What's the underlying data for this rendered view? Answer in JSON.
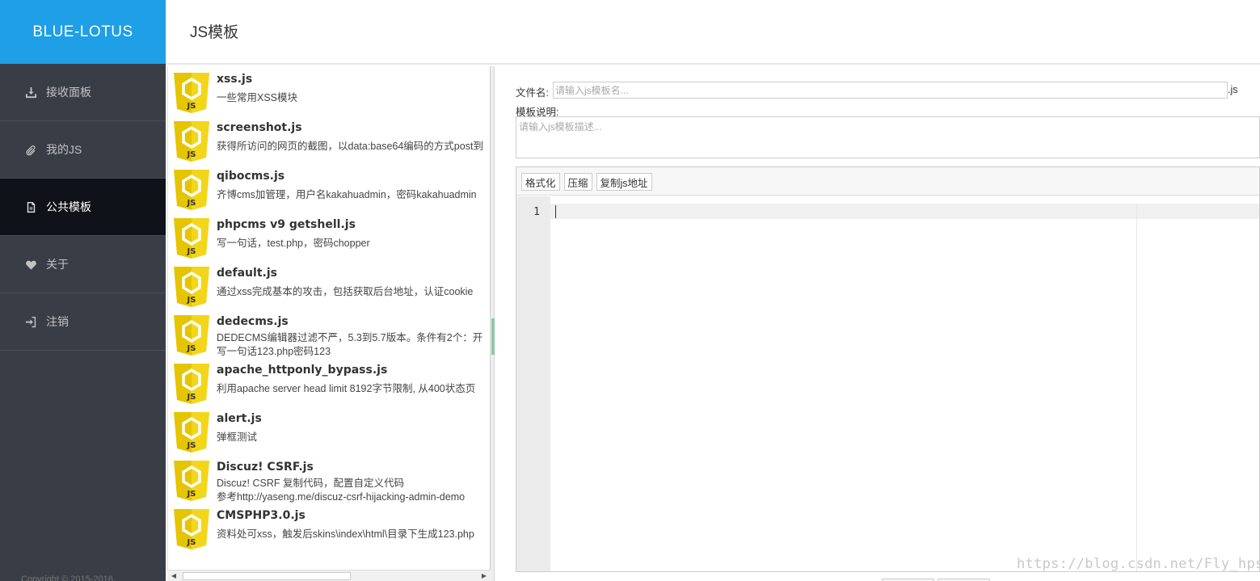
{
  "brand": "BLUE-LOTUS",
  "header": {
    "title": "JS模板"
  },
  "sidebar": {
    "items": [
      {
        "label": "接收面板",
        "icon": "download-icon",
        "active": false
      },
      {
        "label": "我的JS",
        "icon": "paperclip-icon",
        "active": false
      },
      {
        "label": "公共模板",
        "icon": "document-icon",
        "active": true
      },
      {
        "label": "关于",
        "icon": "heart-icon",
        "active": false
      },
      {
        "label": "注销",
        "icon": "logout-icon",
        "active": false
      }
    ],
    "copyright": "Copyright © 2015-2016"
  },
  "templates": [
    {
      "name": "xss.js",
      "desc": [
        "一些常用XSS模块"
      ]
    },
    {
      "name": "screenshot.js",
      "desc": [
        "获得所访问的网页的截图，以data:base64编码的方式post到"
      ]
    },
    {
      "name": "qibocms.js",
      "desc": [
        "齐博cms加管理，用户名kakahuadmin，密码kakahuadmin"
      ]
    },
    {
      "name": "phpcms v9 getshell.js",
      "desc": [
        "写一句话，test.php，密码chopper"
      ]
    },
    {
      "name": "default.js",
      "desc": [
        "通过xss完成基本的攻击，包括获取后台地址，认证cookie"
      ]
    },
    {
      "name": "dedecms.js",
      "desc": [
        "DEDECMS编辑器过滤不严，5.3到5.7版本。条件有2个：开",
        "写一句话123.php密码123"
      ]
    },
    {
      "name": "apache_httponly_bypass.js",
      "desc": [
        "利用apache server head limit 8192字节限制, 从400状态页"
      ]
    },
    {
      "name": "alert.js",
      "desc": [
        "弹框测试"
      ]
    },
    {
      "name": "Discuz!  CSRF.js",
      "desc": [
        "Discuz!  CSRF  复制代码，配置自定义代码",
        "参考http://yaseng.me/discuz-csrf-hijacking-admin-demo"
      ]
    },
    {
      "name": "CMSPHP3.0.js",
      "desc": [
        "资料处可xss，触发后skins\\index\\html\\目录下生成123.php"
      ]
    }
  ],
  "logo_text": "JS",
  "form": {
    "filename_label": "文件名:",
    "filename_placeholder": "请输入js模板名...",
    "filename_suffix": ".js",
    "desc_label": "模板说明:",
    "desc_placeholder": "请输入js模板描述..."
  },
  "editor": {
    "toolbar": {
      "format": "格式化",
      "compress": "压缩",
      "copy_url": "复制js地址"
    },
    "line_number": "1"
  },
  "watermark": "https://blog.csdn.net/Fly_hps",
  "colors": {
    "brand": "#1e9fe6",
    "sidebar": "#393d46",
    "active": "#0f1218",
    "js_logo": "#f0d400"
  }
}
